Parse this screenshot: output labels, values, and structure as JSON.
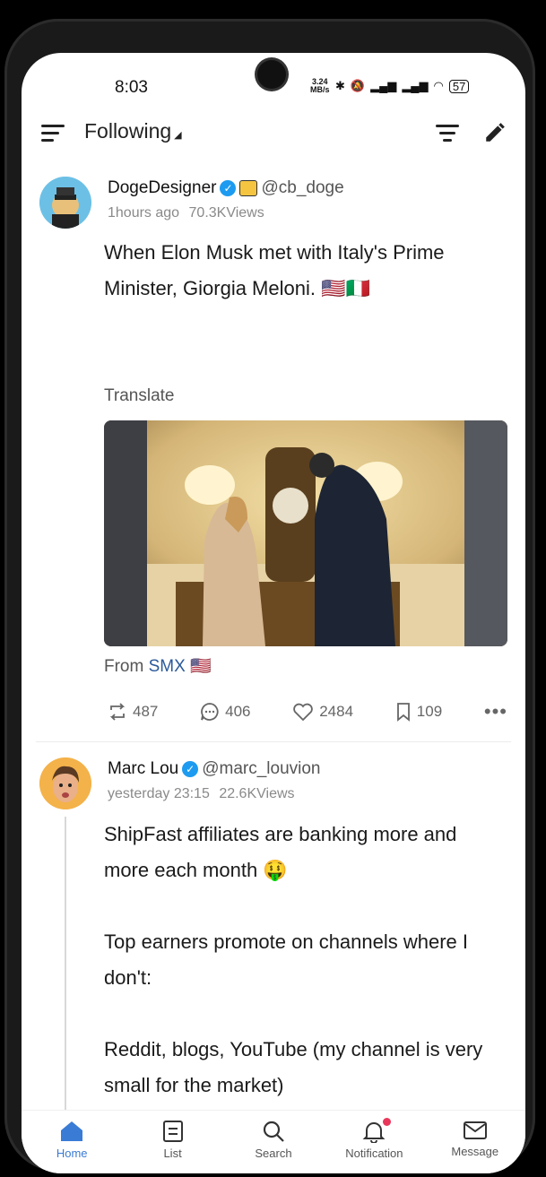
{
  "status_bar": {
    "time": "8:03",
    "net_rate_value": "3.24",
    "net_rate_unit": "MB/s",
    "battery": "57"
  },
  "header": {
    "feed_title": "Following",
    "feed_caret": "◢"
  },
  "posts": [
    {
      "name": "DogeDesigner",
      "handle": "@cb_doge",
      "time": "1hours ago",
      "views": "70.3KViews",
      "text": "When Elon Musk met with Italy's Prime\nMinister, Giorgia Meloni. 🇺🇸🇮🇹",
      "translate_label": "Translate",
      "source_prefix": "From ",
      "source_name": "SMX",
      "source_flag": "🇺🇸",
      "reposts": "487",
      "comments": "406",
      "likes": "2484",
      "bookmarks": "109"
    },
    {
      "name": "Marc Lou",
      "handle": "@marc_louvion",
      "time": "yesterday 23:15",
      "views": "22.6KViews",
      "text": "ShipFast affiliates are banking more and\nmore each month 🤑\n\nTop earners promote on channels where I\ndon't:\n\nReddit, blogs, YouTube (my channel is very\nsmall for the market)"
    }
  ],
  "bottom_nav": [
    {
      "label": "Home",
      "icon": "home-icon",
      "active": true
    },
    {
      "label": "List",
      "icon": "list-icon"
    },
    {
      "label": "Search",
      "icon": "search-icon"
    },
    {
      "label": "Notification",
      "icon": "bell-icon"
    },
    {
      "label": "Message",
      "icon": "mail-icon"
    }
  ],
  "colors": {
    "accent": "#3a7bd5",
    "verified": "#1d9bf0",
    "notification_dot": "#e8375a"
  }
}
